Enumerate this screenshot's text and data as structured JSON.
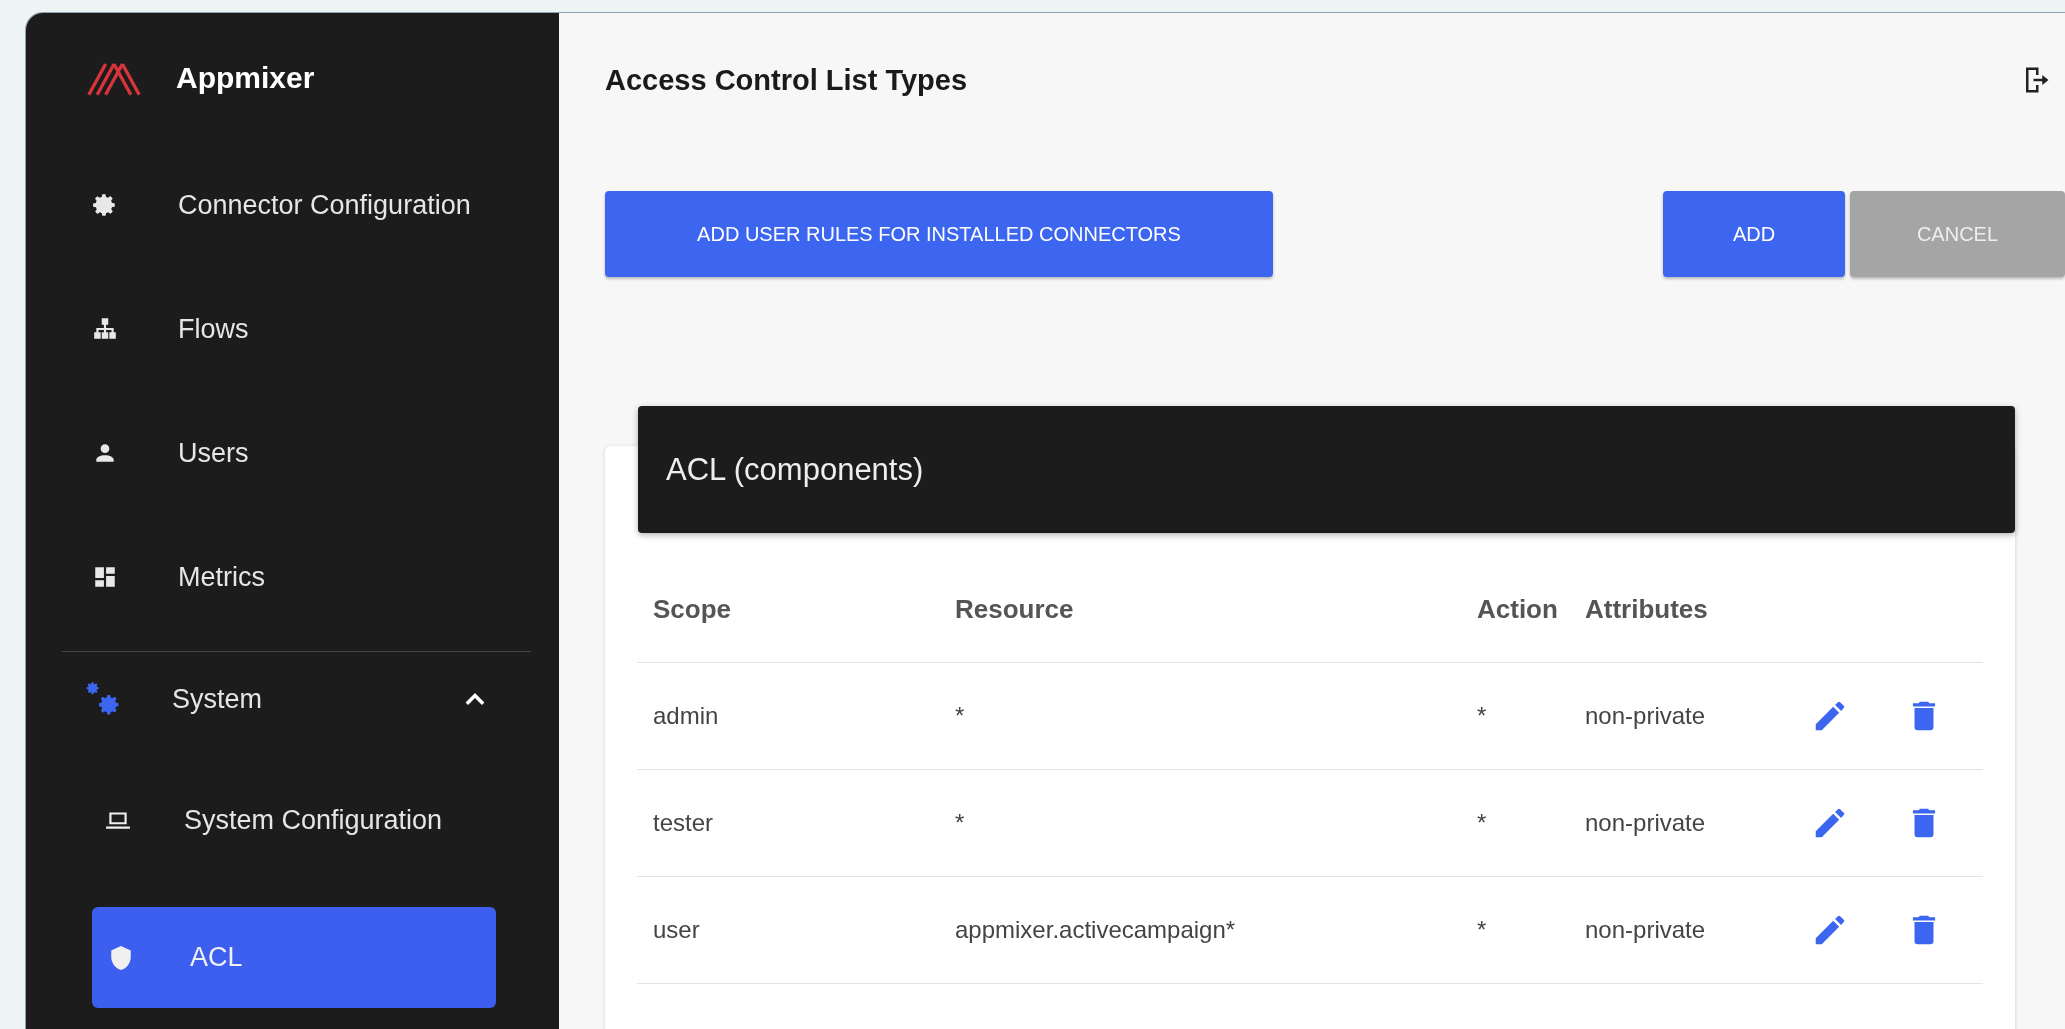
{
  "sidebar": {
    "brand": "Appmixer",
    "items": [
      {
        "kind": "item",
        "label": "Connector Configuration",
        "selected": false
      },
      {
        "kind": "item",
        "label": "Flows",
        "selected": false
      },
      {
        "kind": "item",
        "label": "Users",
        "selected": false
      },
      {
        "kind": "item",
        "label": "Metrics",
        "selected": false
      },
      {
        "kind": "group",
        "label": "System",
        "expanded": true,
        "children": [
          {
            "label": "System Configuration",
            "selected": false
          },
          {
            "label": "ACL",
            "selected": true
          }
        ]
      }
    ]
  },
  "header": {
    "title": "Access Control List Types"
  },
  "actions": {
    "left": "ADD USER RULES FOR INSTALLED CONNECTORS",
    "add": "ADD",
    "cancel": "CANCEL",
    "cancel_disabled": true
  },
  "card": {
    "title": "ACL (components)",
    "columns": [
      "Scope",
      "Resource",
      "Action",
      "Attributes"
    ],
    "rows": [
      {
        "scope": "admin",
        "resource": "*",
        "action": "*",
        "attributes": "non-private"
      },
      {
        "scope": "tester",
        "resource": "*",
        "action": "*",
        "attributes": "non-private"
      },
      {
        "scope": "user",
        "resource": "appmixer.activecampaign*",
        "action": "*",
        "attributes": "non-private"
      }
    ]
  }
}
